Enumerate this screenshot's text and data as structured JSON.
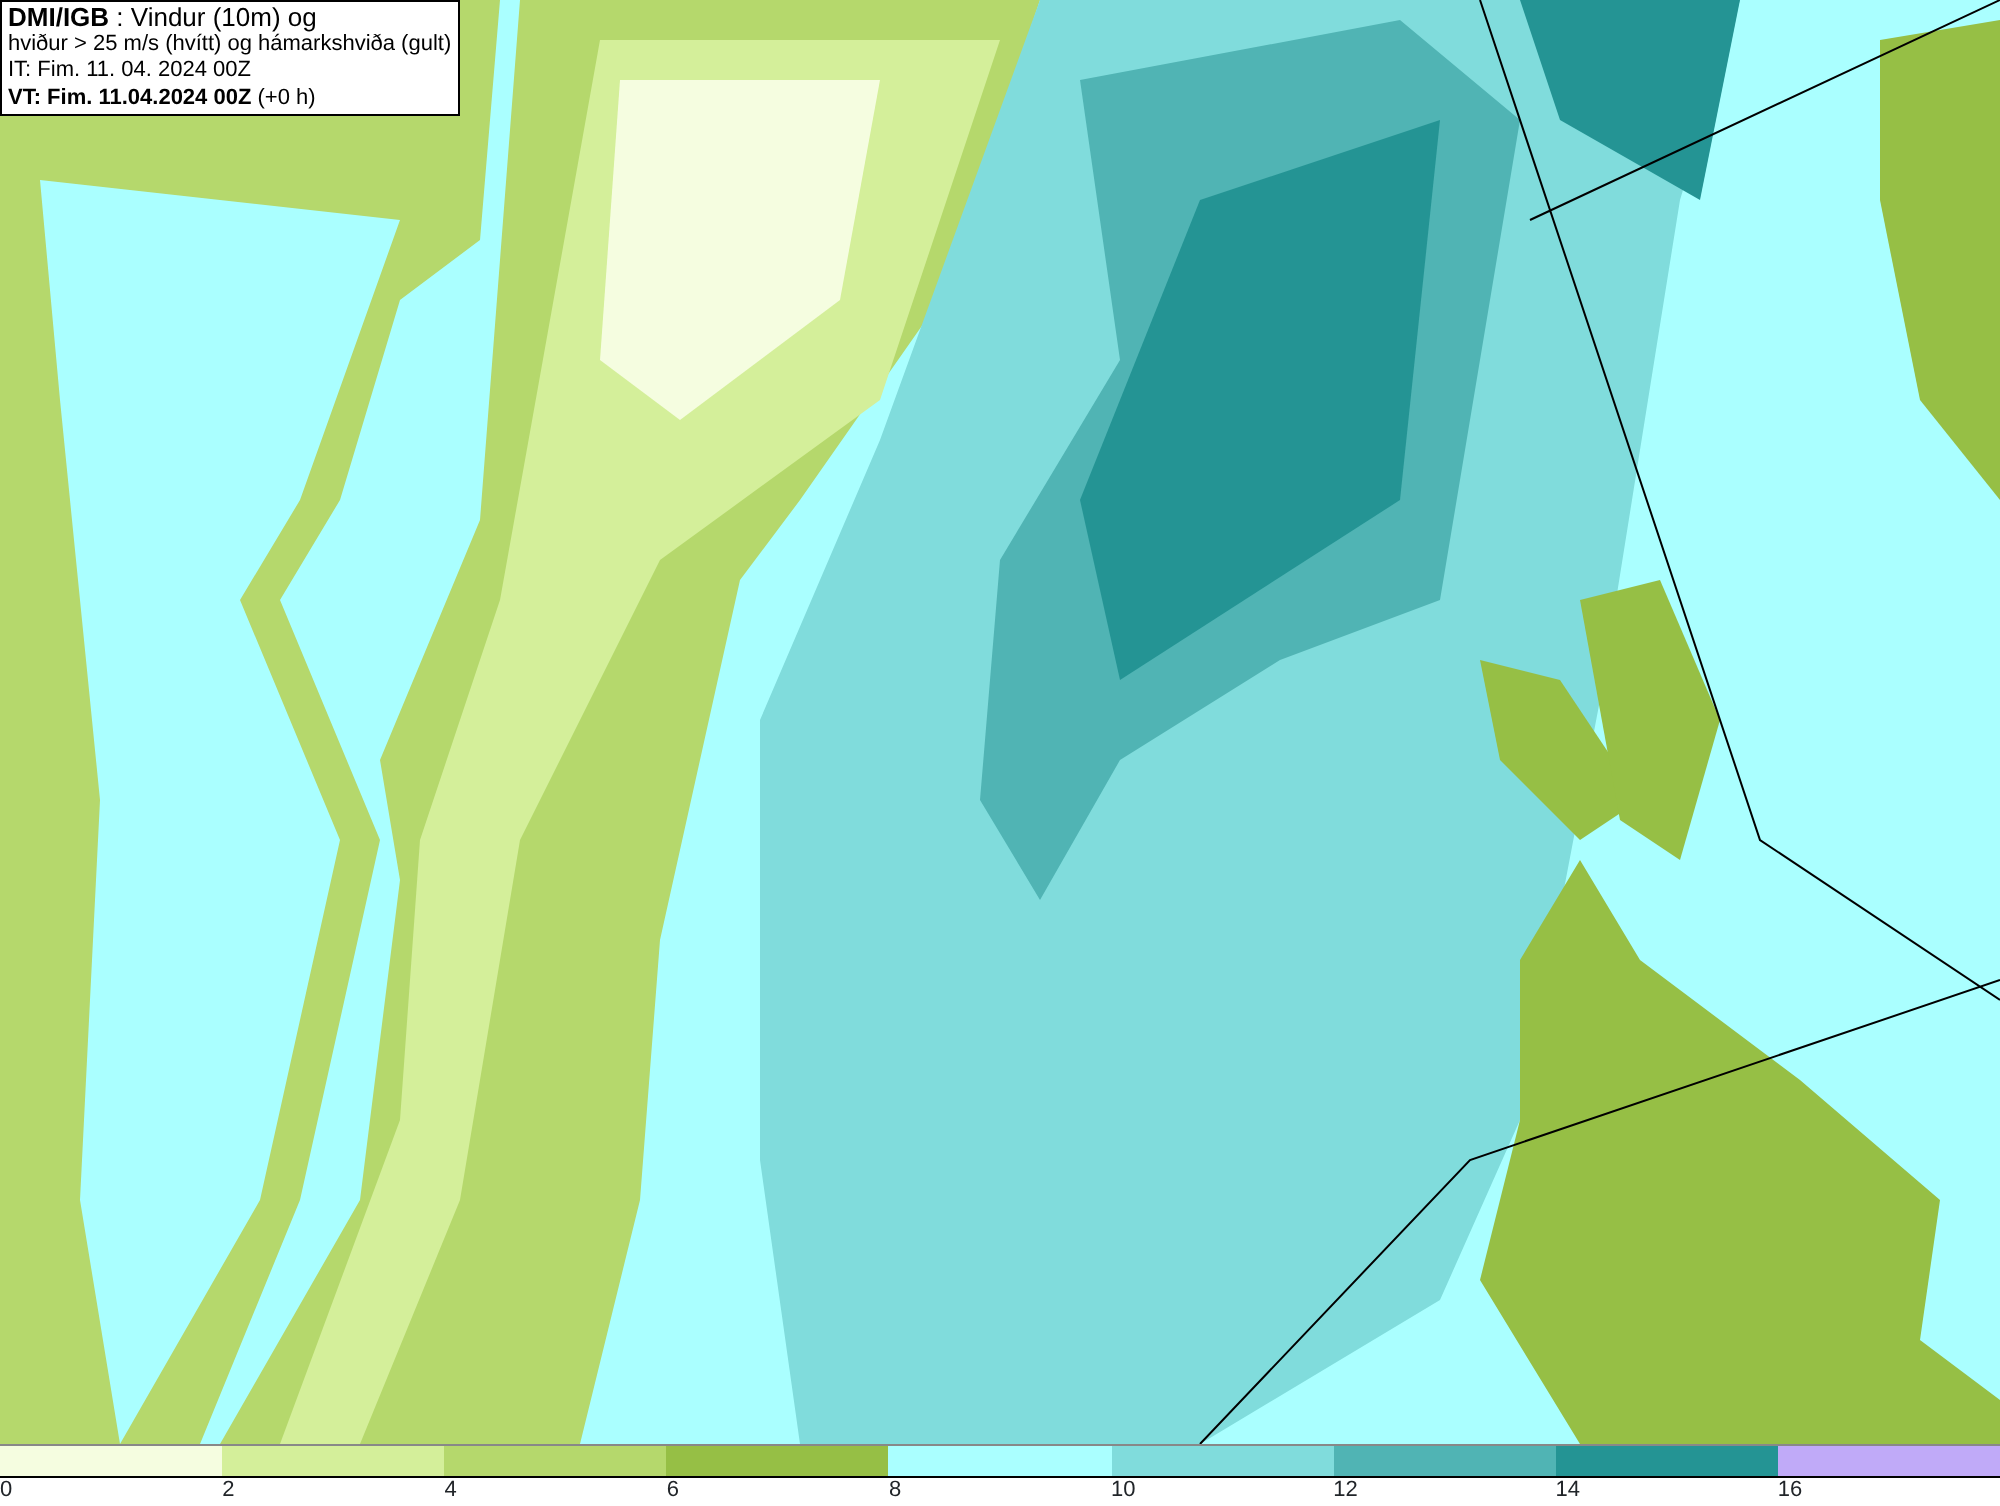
{
  "title_box": {
    "lines": [
      "**DMI/IGB** : Vindur (10m) og",
      "hviður > 25 m/s (hvítt) og hámarkshviða (gult)",
      "IT: Fim. 11. 04. 2024 00Z",
      "**VT: Fim. 11.04.2024 00Z** (+0 h)"
    ]
  },
  "legend": {
    "bins": [
      {
        "color": "#f5fde0"
      },
      {
        "color": "#d4ef9a"
      },
      {
        "color": "#b5d86c"
      },
      {
        "color": "#96bf45"
      },
      {
        "color": "#aaffff"
      },
      {
        "color": "#80dcdc"
      },
      {
        "color": "#50b4b4"
      },
      {
        "color": "#249494"
      },
      {
        "color": "#c0aaf8"
      }
    ],
    "ticks": [
      "0",
      "2",
      "4",
      "6",
      "8",
      "10",
      "12",
      "14",
      "16"
    ]
  }
}
